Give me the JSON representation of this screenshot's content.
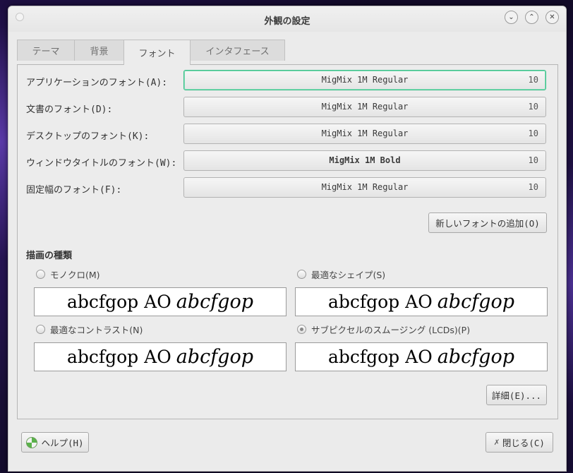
{
  "window": {
    "title": "外観の設定"
  },
  "tabs": [
    {
      "label": "テーマ",
      "active": false
    },
    {
      "label": "背景",
      "active": false
    },
    {
      "label": "フォント",
      "active": true
    },
    {
      "label": "インタフェース",
      "active": false
    }
  ],
  "fonts": [
    {
      "label": "アプリケーションのフォント(A):",
      "name": "MigMix 1M Regular",
      "size": "10"
    },
    {
      "label": "文書のフォント(D):",
      "name": "MigMix 1M Regular",
      "size": "10"
    },
    {
      "label": "デスクトップのフォント(K):",
      "name": "MigMix 1M Regular",
      "size": "10"
    },
    {
      "label": "ウィンドウタイトルのフォント(W):",
      "name": "MigMix 1M Bold",
      "size": "10"
    },
    {
      "label": "固定幅のフォント(F):",
      "name": "MigMix 1M Regular",
      "size": "10"
    }
  ],
  "add_font_button": "新しいフォントの追加(O)",
  "rendering": {
    "title": "描画の種類",
    "sample_text": "abcfgop AO",
    "sample_italic": "abcfgop",
    "options": [
      {
        "label": "モノクロ(M)",
        "checked": false
      },
      {
        "label": "最適なシェイプ(S)",
        "checked": false
      },
      {
        "label": "最適なコントラスト(N)",
        "checked": false
      },
      {
        "label": "サブピクセルのスムージング (LCDs)(P)",
        "checked": true
      }
    ]
  },
  "details_button": "詳細(E)...",
  "help_button": "ヘルプ(H)",
  "close_button": "閉じる(C)",
  "icons": {
    "title_menu": "circle-dot-icon",
    "minimize": "chevron-down-icon",
    "maximize": "chevron-up-icon",
    "close": "close-icon",
    "help": "help-lifebuoy-icon",
    "close_dialog": "x-icon"
  },
  "colors": {
    "focus_border": "#3cbf8a",
    "window_bg": "#ebebeb"
  }
}
